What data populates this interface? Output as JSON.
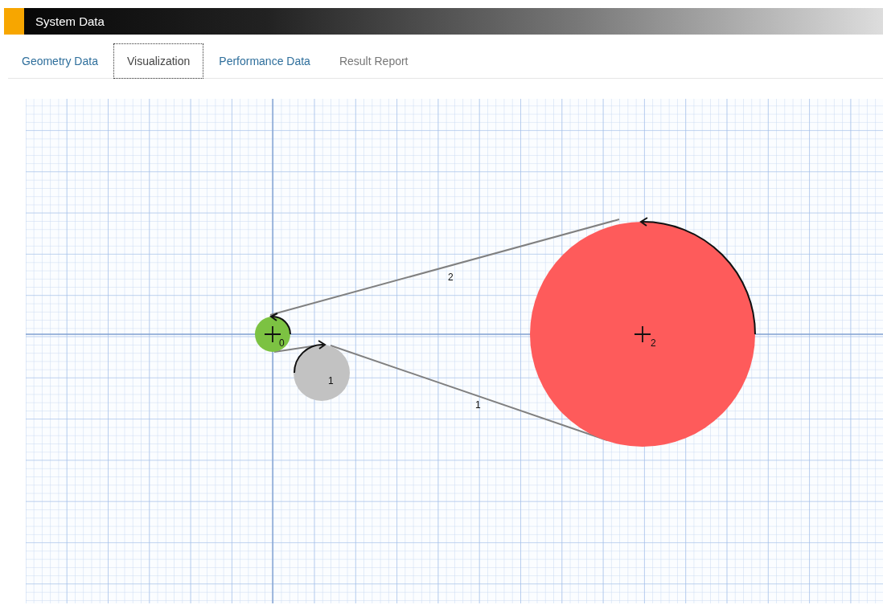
{
  "header": {
    "title": "System Data"
  },
  "tabs": [
    {
      "label": "Geometry Data",
      "selected": false,
      "disabled": false
    },
    {
      "label": "Visualization",
      "selected": true,
      "disabled": false
    },
    {
      "label": "Performance Data",
      "selected": false,
      "disabled": false
    },
    {
      "label": "Result Report",
      "selected": false,
      "disabled": true
    }
  ],
  "pulleys": [
    {
      "label": "0",
      "color": "#7cc242",
      "center_mark": true
    },
    {
      "label": "1",
      "color": "#c2c2c2",
      "center_mark": false
    },
    {
      "label": "2",
      "color": "#fe5b5b",
      "center_mark": true
    }
  ],
  "belts": [
    {
      "label": "2"
    },
    {
      "label": "1"
    }
  ]
}
